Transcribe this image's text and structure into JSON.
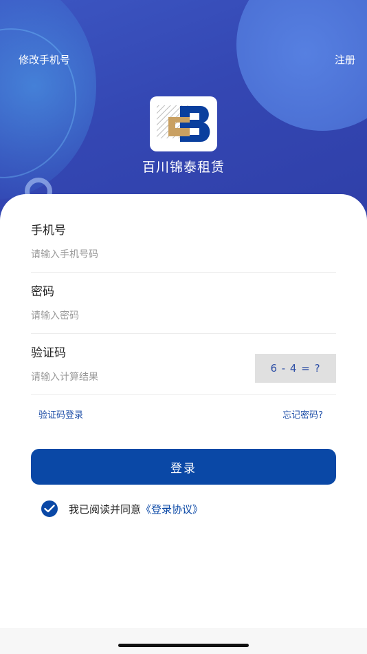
{
  "header": {
    "left_link": "修改手机号",
    "right_link": "注册",
    "brand_name": "百川锦泰租赁",
    "logo_icon": "bcjt-logo"
  },
  "form": {
    "phone": {
      "label": "手机号",
      "placeholder": "请输入手机号码"
    },
    "password": {
      "label": "密码",
      "placeholder": "请输入密码"
    },
    "captcha": {
      "label": "验证码",
      "placeholder": "请输入计算结果",
      "challenge": "6 - 4 = ?"
    },
    "sms_login": "验证码登录",
    "forgot_password": "忘记密码?",
    "submit": "登录"
  },
  "agreement": {
    "checked": true,
    "text": "我已阅读并同意",
    "link": "《登录协议》"
  },
  "colors": {
    "primary": "#0a48a6",
    "hero": "#3447b3",
    "link": "#1f4fa8"
  }
}
